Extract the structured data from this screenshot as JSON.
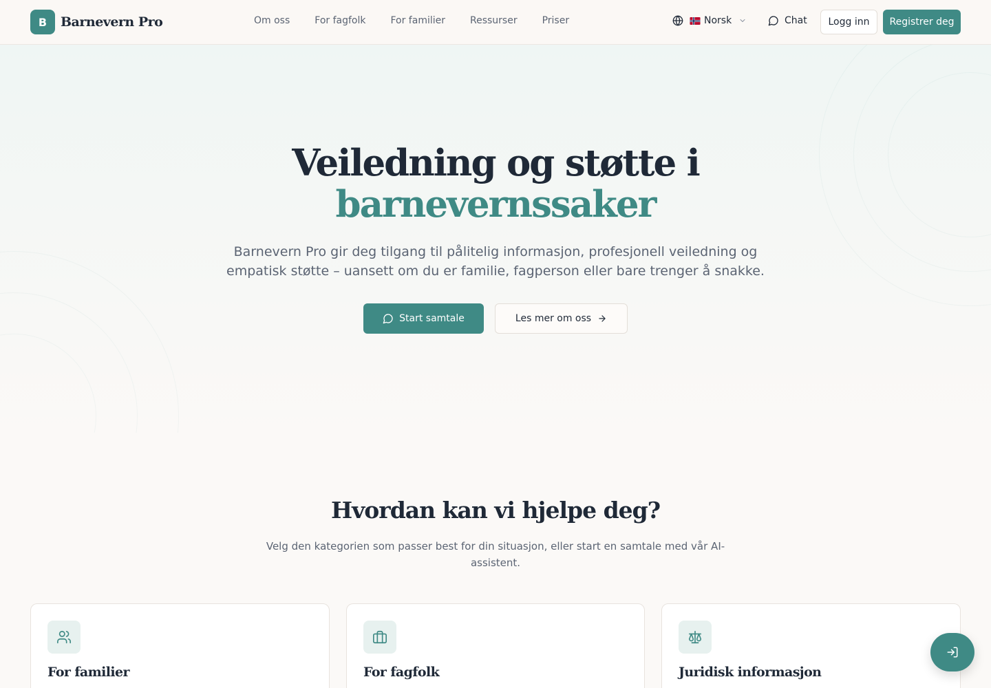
{
  "brand": {
    "logo_letter": "B",
    "name": "Barnevern Pro",
    "accent_color": "#3f8a85"
  },
  "nav": {
    "items": [
      {
        "label": "Om oss"
      },
      {
        "label": "For fagfolk"
      },
      {
        "label": "For familier"
      },
      {
        "label": "Ressurser"
      },
      {
        "label": "Priser"
      }
    ]
  },
  "header": {
    "language": {
      "icon": "globe-icon",
      "flag": "norway-flag",
      "label": "Norsk"
    },
    "chat_label": "Chat",
    "login_label": "Logg inn",
    "register_label": "Registrer deg"
  },
  "hero": {
    "title_line1": "Veiledning og støtte i",
    "title_line2": "barnevernssaker",
    "subtitle": "Barnevern Pro gir deg tilgang til pålitelig informasjon, profesjonell veiledning og empatisk støtte – uansett om du er familie, fagperson eller bare trenger å snakke.",
    "primary_cta": "Start samtale",
    "secondary_cta": "Les mer om oss"
  },
  "help": {
    "title": "Hvordan kan vi hjelpe deg?",
    "subtitle": "Velg den kategorien som passer best for din situasjon, eller start en samtale med vår AI-assistent.",
    "cards": [
      {
        "title": "For familier",
        "icon": "users-icon"
      },
      {
        "title": "For fagfolk",
        "icon": "briefcase-icon"
      },
      {
        "title": "Juridisk informasjon",
        "icon": "scale-icon"
      }
    ]
  },
  "fab": {
    "icon": "login-icon"
  }
}
